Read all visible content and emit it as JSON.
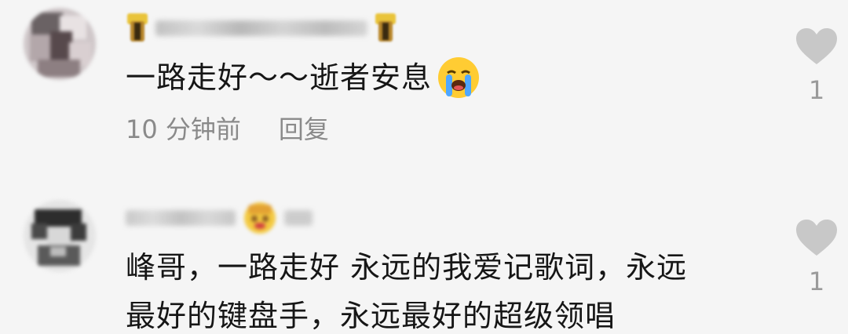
{
  "comments": [
    {
      "text": "一路走好～～逝者安息",
      "emoji": "loudly-crying-face",
      "time": "10 分钟前",
      "reply_label": "回复",
      "likes": "1"
    },
    {
      "text_line1": "峰哥，一路走好 永远的我爱记歌词，永远",
      "text_line2": "最好的键盘手，永远最好的超级领唱",
      "likes": "1"
    }
  ],
  "colors": {
    "background": "#f5f5f5",
    "text": "#161616",
    "meta": "#8a8a8a",
    "heart": "#c8c8c8"
  }
}
